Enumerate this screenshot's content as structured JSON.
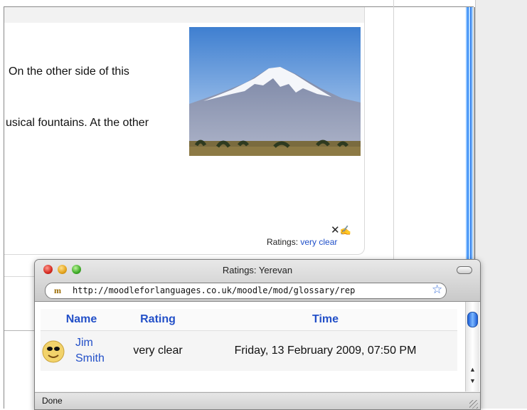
{
  "background": {
    "text_line_1": "On the other side of this",
    "text_line_2": "usical fountains. At the other",
    "image_alt": "Snow-capped Mount Ararat photo",
    "tools": {
      "delete_glyph": "✕",
      "edit_glyph": "✍"
    },
    "ratings_label": "Ratings:",
    "ratings_value": "very clear"
  },
  "popup": {
    "title": "Ratings: Yerevan",
    "url": "http://moodleforlanguages.co.uk/moodle/mod/glossary/rep",
    "favicon": "m",
    "bookmark_icon": "☆",
    "table": {
      "headers": [
        "Name",
        "Rating",
        "Time"
      ],
      "rows": [
        {
          "name_first": "Jim",
          "name_last": "Smith",
          "rating": "very clear",
          "time": "Friday, 13 February 2009, 07:50 PM"
        }
      ]
    },
    "scroll_up_arrow": "▲",
    "scroll_down_arrow": "▼",
    "status": "Done"
  },
  "colors": {
    "link": "#2350c8",
    "accent_blue": "#3a8df5"
  }
}
